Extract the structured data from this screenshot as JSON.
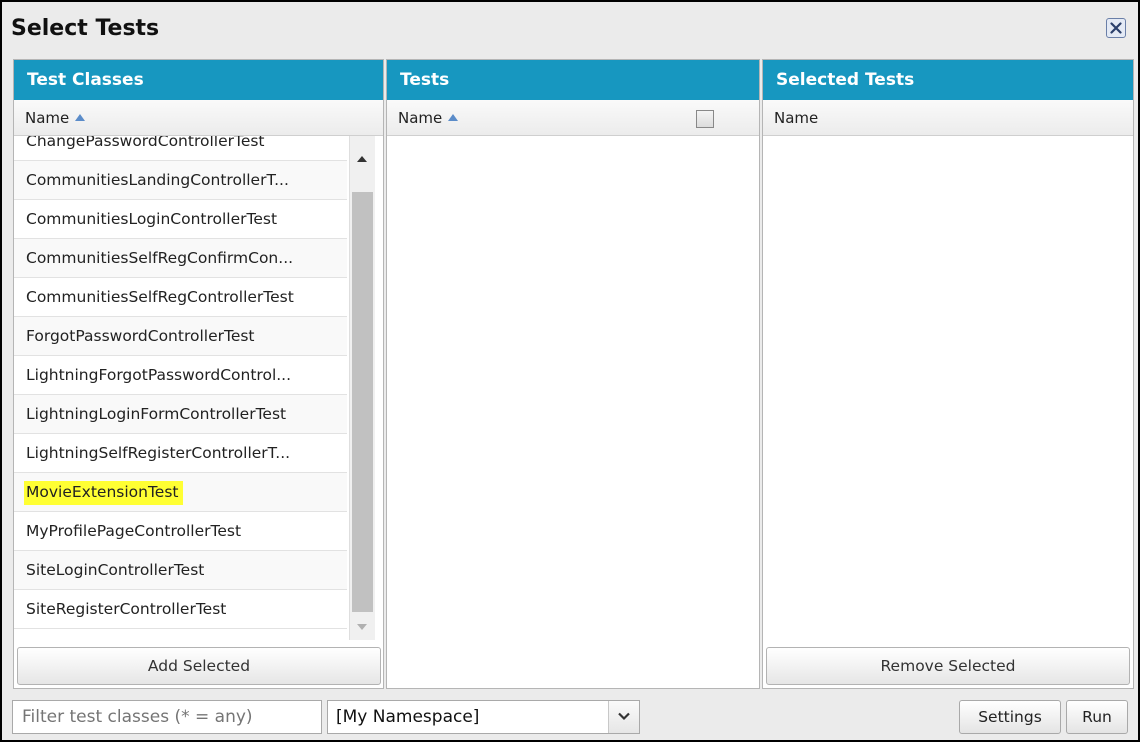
{
  "dialog": {
    "title": "Select Tests",
    "close_icon": "close-icon"
  },
  "test_classes": {
    "header": "Test Classes",
    "column_name": "Name",
    "items": [
      "ChangePasswordControllerTest",
      "CommunitiesLandingControllerT...",
      "CommunitiesLoginControllerTest",
      "CommunitiesSelfRegConfirmCon...",
      "CommunitiesSelfRegControllerTest",
      "ForgotPasswordControllerTest",
      "LightningForgotPasswordControl...",
      "LightningLoginFormControllerTest",
      "LightningSelfRegisterControllerT...",
      "MovieExtensionTest",
      "MyProfilePageControllerTest",
      "SiteLoginControllerTest",
      "SiteRegisterControllerTest"
    ],
    "highlighted_item": "MovieExtensionTest",
    "highlight_color": "#ffff33",
    "button": "Add Selected"
  },
  "tests": {
    "header": "Tests",
    "column_name": "Name",
    "select_all_checked": false
  },
  "selected_tests": {
    "header": "Selected Tests",
    "column_name": "Name",
    "button": "Remove Selected"
  },
  "bottom_bar": {
    "filter_placeholder": "Filter test classes (* = any)",
    "namespace_selected": "[My Namespace]",
    "settings_button": "Settings",
    "run_button": "Run"
  },
  "colors": {
    "header_blue": "#1797c0",
    "background": "#ebebeb"
  }
}
